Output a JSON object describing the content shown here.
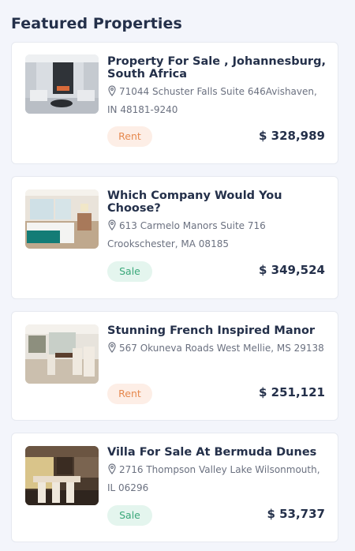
{
  "section": {
    "title": "Featured Properties"
  },
  "colors": {
    "rent_bg": "#fdeee6",
    "rent_text": "#e6894f",
    "sale_bg": "#e4f5ee",
    "sale_text": "#3aa87a",
    "heading": "#24304a"
  },
  "properties": [
    {
      "title": "Property For Sale , Johannesburg, South Africa",
      "address": "71044 Schuster Falls Suite 646Avishaven, IN 48181-9240",
      "badge": "Rent",
      "price": "$ 328,989",
      "image_icon": "living-room-photo"
    },
    {
      "title": "Which Company Would You Choose?",
      "address": "613 Carmelo Manors Suite 716 Crookschester, MA 08185",
      "badge": "Sale",
      "price": "$ 349,524",
      "image_icon": "bedroom-photo"
    },
    {
      "title": "Stunning French Inspired Manor",
      "address": "567 Okuneva Roads West Mellie, MS 29138",
      "badge": "Rent",
      "price": "$ 251,121",
      "image_icon": "dining-room-photo"
    },
    {
      "title": "Villa For Sale At Bermuda Dunes",
      "title_prefix": "",
      "address": "2716 Thompson Valley Lake Wilsonmouth, IL 06296",
      "badge": "Sale",
      "price": "$ 53,737",
      "image_icon": "kitchen-photo"
    }
  ]
}
